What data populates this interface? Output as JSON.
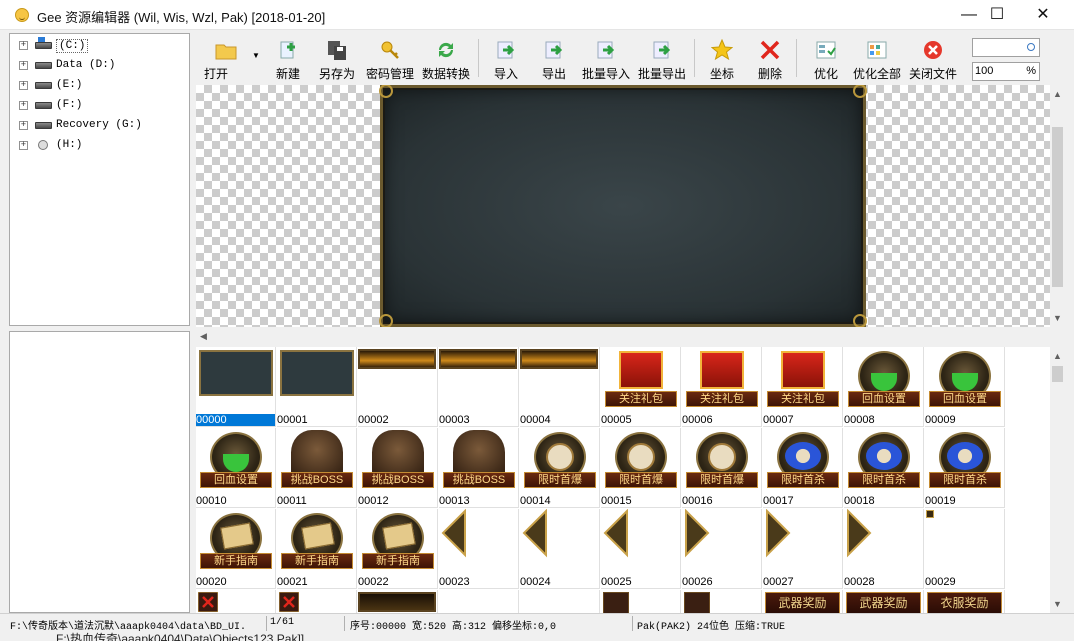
{
  "window": {
    "title": "Gee 资源编辑器 (Wil, Wis, Wzl, Pak) [2018-01-20]",
    "minimize": "—",
    "maximize": "☐",
    "close": "✕"
  },
  "tree": [
    {
      "label": "(C:)",
      "selected": true,
      "icon": "system-drive-icon"
    },
    {
      "label": "Data (D:)",
      "icon": "drive-icon"
    },
    {
      "label": "(E:)",
      "icon": "drive-icon"
    },
    {
      "label": "(F:)",
      "icon": "drive-icon"
    },
    {
      "label": "Recovery (G:)",
      "icon": "drive-icon"
    },
    {
      "label": "(H:)",
      "icon": "cd-drive-icon"
    }
  ],
  "toolbar": {
    "open": "打开",
    "new": "新建",
    "save_as": "另存为",
    "password": "密码管理",
    "convert": "数据转换",
    "import": "导入",
    "export": "导出",
    "batch_import": "批量导入",
    "batch_export": "批量导出",
    "coords": "坐标",
    "delete": "删除",
    "optimize": "优化",
    "optimize_all": "优化全部",
    "close_file": "关闭文件",
    "search_value": "",
    "zoom": "100",
    "zoom_unit": "%"
  },
  "grid": {
    "rows": [
      [
        {
          "id": "00000",
          "type": "panel",
          "selected": true
        },
        {
          "id": "00001",
          "type": "panel"
        },
        {
          "id": "00002",
          "type": "bar"
        },
        {
          "id": "00003",
          "type": "bar"
        },
        {
          "id": "00004",
          "type": "bar"
        },
        {
          "id": "00005",
          "type": "gift",
          "caption": "关注礼包"
        },
        {
          "id": "00006",
          "type": "gift",
          "caption": "关注礼包"
        },
        {
          "id": "00007",
          "type": "gift",
          "caption": "关注礼包"
        },
        {
          "id": "00008",
          "type": "potion",
          "caption": "回血设置"
        },
        {
          "id": "00009",
          "type": "potion",
          "caption": "回血设置"
        }
      ],
      [
        {
          "id": "00010",
          "type": "potion",
          "caption": "回血设置"
        },
        {
          "id": "00011",
          "type": "boss",
          "caption": "挑战BOSS"
        },
        {
          "id": "00012",
          "type": "boss",
          "caption": "挑战BOSS"
        },
        {
          "id": "00013",
          "type": "boss",
          "caption": "挑战BOSS"
        },
        {
          "id": "00014",
          "type": "clock",
          "caption": "限时首爆"
        },
        {
          "id": "00015",
          "type": "clock",
          "caption": "限时首爆"
        },
        {
          "id": "00016",
          "type": "clock",
          "caption": "限时首爆"
        },
        {
          "id": "00017",
          "type": "clock-blue",
          "caption": "限时首杀"
        },
        {
          "id": "00018",
          "type": "clock-blue",
          "caption": "限时首杀"
        },
        {
          "id": "00019",
          "type": "clock-blue",
          "caption": "限时首杀"
        }
      ],
      [
        {
          "id": "00020",
          "type": "guide",
          "caption": "新手指南"
        },
        {
          "id": "00021",
          "type": "guide",
          "caption": "新手指南"
        },
        {
          "id": "00022",
          "type": "guide",
          "caption": "新手指南"
        },
        {
          "id": "00023",
          "type": "arrow-left"
        },
        {
          "id": "00024",
          "type": "arrow-left"
        },
        {
          "id": "00025",
          "type": "arrow-left"
        },
        {
          "id": "00026",
          "type": "arrow-right"
        },
        {
          "id": "00027",
          "type": "arrow-right"
        },
        {
          "id": "00028",
          "type": "arrow-right"
        },
        {
          "id": "00029",
          "type": "tiny"
        }
      ],
      [
        {
          "id": "",
          "type": "redx"
        },
        {
          "id": "",
          "type": "redx"
        },
        {
          "id": "",
          "type": "darkbar"
        },
        {
          "id": "",
          "type": "empty"
        },
        {
          "id": "",
          "type": "empty"
        },
        {
          "id": "",
          "type": "dark"
        },
        {
          "id": "",
          "type": "dark"
        },
        {
          "id": "",
          "type": "ribbon",
          "caption": "武器奖励"
        },
        {
          "id": "",
          "type": "ribbon",
          "caption": "武器奖励"
        },
        {
          "id": "",
          "type": "ribbon",
          "caption": "衣服奖励"
        }
      ]
    ]
  },
  "status": {
    "path": "F:\\传奇版本\\道法沉默\\aaapk0404\\data\\BD_UI.",
    "index": "1/61",
    "info": "序号:00000 宽:520 高:312 偏移坐标:0,0",
    "format": "Pak(PAK2) 24位色 压缩:TRUE"
  },
  "background_text": "F:\\热血传奇\\aaapk0404\\Data\\Objects123.Pak]]",
  "colors": {
    "selection": "#0078d7",
    "gold": "#b9973c"
  }
}
